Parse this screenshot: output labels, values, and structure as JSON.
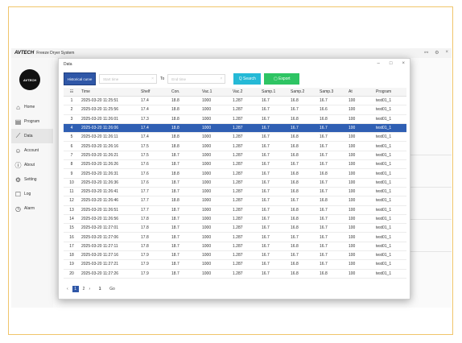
{
  "app": {
    "brand": "AVTECH",
    "title": "Freeze Dryer System",
    "logo_text": "AVTECH",
    "window_controls": [
      "⚯",
      "⚙",
      "×"
    ]
  },
  "sidebar": {
    "items": [
      {
        "label": "Home",
        "icon": "home-icon",
        "glyph": "⌂"
      },
      {
        "label": "Program",
        "icon": "program-icon",
        "glyph": "▤"
      },
      {
        "label": "Data",
        "icon": "chart-icon",
        "glyph": "⟋"
      },
      {
        "label": "Account",
        "icon": "user-icon",
        "glyph": "☺"
      },
      {
        "label": "About",
        "icon": "info-icon",
        "glyph": "ⓘ"
      },
      {
        "label": "Setting",
        "icon": "gear-icon",
        "glyph": "⚙"
      },
      {
        "label": "Log",
        "icon": "log-icon",
        "glyph": "☐"
      },
      {
        "label": "Alarm",
        "icon": "clock-icon",
        "glyph": "◷"
      }
    ]
  },
  "dialog": {
    "title": "Data",
    "controls": [
      "–",
      "□",
      "×"
    ],
    "historical_label": "Historical curve",
    "start_placeholder": "Start time",
    "to_label": "To",
    "end_placeholder": "End time",
    "search_label": "Q Search",
    "export_label": "▢ Export",
    "columns": [
      "",
      "Time",
      "Shelf",
      "Con.",
      "Vac.1",
      "Vac.2",
      "Samp.1",
      "Samp.2",
      "Samp.3",
      "At",
      "Program"
    ],
    "rows": [
      [
        "1",
        "2025-03-20 11:25:51",
        "17.4",
        "18.8",
        "1000",
        "1.287",
        "16.7",
        "16.8",
        "16.7",
        "100",
        "test01_1"
      ],
      [
        "2",
        "2025-03-20 11:25:56",
        "17.4",
        "18.8",
        "1000",
        "1.287",
        "16.7",
        "16.7",
        "16.6",
        "100",
        "test01_1"
      ],
      [
        "3",
        "2025-03-20 11:26:01",
        "17.3",
        "18.8",
        "1000",
        "1.287",
        "16.7",
        "16.8",
        "16.8",
        "100",
        "test01_1"
      ],
      [
        "4",
        "2025-03-20 11:26:06",
        "17.4",
        "18.8",
        "1000",
        "1.287",
        "16.7",
        "16.7",
        "16.7",
        "100",
        "test01_1"
      ],
      [
        "5",
        "2025-03-20 11:26:11",
        "17.4",
        "18.8",
        "1000",
        "1.287",
        "16.7",
        "16.8",
        "16.7",
        "100",
        "test01_1"
      ],
      [
        "6",
        "2025-03-20 11:26:16",
        "17.5",
        "18.8",
        "1000",
        "1.287",
        "16.7",
        "16.8",
        "16.7",
        "100",
        "test01_1"
      ],
      [
        "7",
        "2025-03-20 11:26:21",
        "17.5",
        "18.7",
        "1000",
        "1.287",
        "16.7",
        "16.8",
        "16.7",
        "100",
        "test01_1"
      ],
      [
        "8",
        "2025-03-20 11:26:26",
        "17.6",
        "18.7",
        "1000",
        "1.287",
        "16.7",
        "16.7",
        "16.7",
        "100",
        "test01_1"
      ],
      [
        "9",
        "2025-03-20 11:26:31",
        "17.6",
        "18.8",
        "1000",
        "1.287",
        "16.7",
        "16.8",
        "16.8",
        "100",
        "test01_1"
      ],
      [
        "10",
        "2025-03-20 11:26:36",
        "17.6",
        "18.7",
        "1000",
        "1.287",
        "16.7",
        "16.8",
        "16.7",
        "100",
        "test01_1"
      ],
      [
        "11",
        "2025-03-20 11:26:41",
        "17.7",
        "18.7",
        "1000",
        "1.287",
        "16.7",
        "16.8",
        "16.7",
        "100",
        "test01_1"
      ],
      [
        "12",
        "2025-03-20 11:26:46",
        "17.7",
        "18.8",
        "1000",
        "1.287",
        "16.7",
        "16.7",
        "16.8",
        "100",
        "test01_1"
      ],
      [
        "13",
        "2025-03-20 11:26:51",
        "17.7",
        "18.7",
        "1000",
        "1.287",
        "16.7",
        "16.8",
        "16.7",
        "100",
        "test01_1"
      ],
      [
        "14",
        "2025-03-20 11:26:56",
        "17.8",
        "18.7",
        "1000",
        "1.287",
        "16.7",
        "16.8",
        "16.7",
        "100",
        "test01_1"
      ],
      [
        "15",
        "2025-03-20 11:27:01",
        "17.8",
        "18.7",
        "1000",
        "1.287",
        "16.7",
        "16.8",
        "16.7",
        "100",
        "test01_1"
      ],
      [
        "16",
        "2025-03-20 11:27:06",
        "17.8",
        "18.7",
        "1000",
        "1.287",
        "16.7",
        "16.7",
        "16.7",
        "100",
        "test01_1"
      ],
      [
        "17",
        "2025-03-20 11:27:11",
        "17.8",
        "18.7",
        "1000",
        "1.287",
        "16.7",
        "16.8",
        "16.7",
        "100",
        "test01_1"
      ],
      [
        "18",
        "2025-03-20 11:27:16",
        "17.9",
        "18.7",
        "1000",
        "1.287",
        "16.7",
        "16.7",
        "16.7",
        "100",
        "test01_1"
      ],
      [
        "19",
        "2025-03-20 11:27:21",
        "17.9",
        "18.7",
        "1000",
        "1.287",
        "16.7",
        "16.8",
        "16.7",
        "100",
        "test01_1"
      ],
      [
        "20",
        "2025-03-20 11:27:26",
        "17.9",
        "18.7",
        "1000",
        "1.287",
        "16.7",
        "16.8",
        "16.8",
        "100",
        "test01_1"
      ]
    ],
    "selected_row": 3,
    "pager": {
      "prev": "‹",
      "current": "1",
      "page2": "2",
      "next": "›",
      "input_value": "1",
      "go_label": "Go"
    }
  }
}
